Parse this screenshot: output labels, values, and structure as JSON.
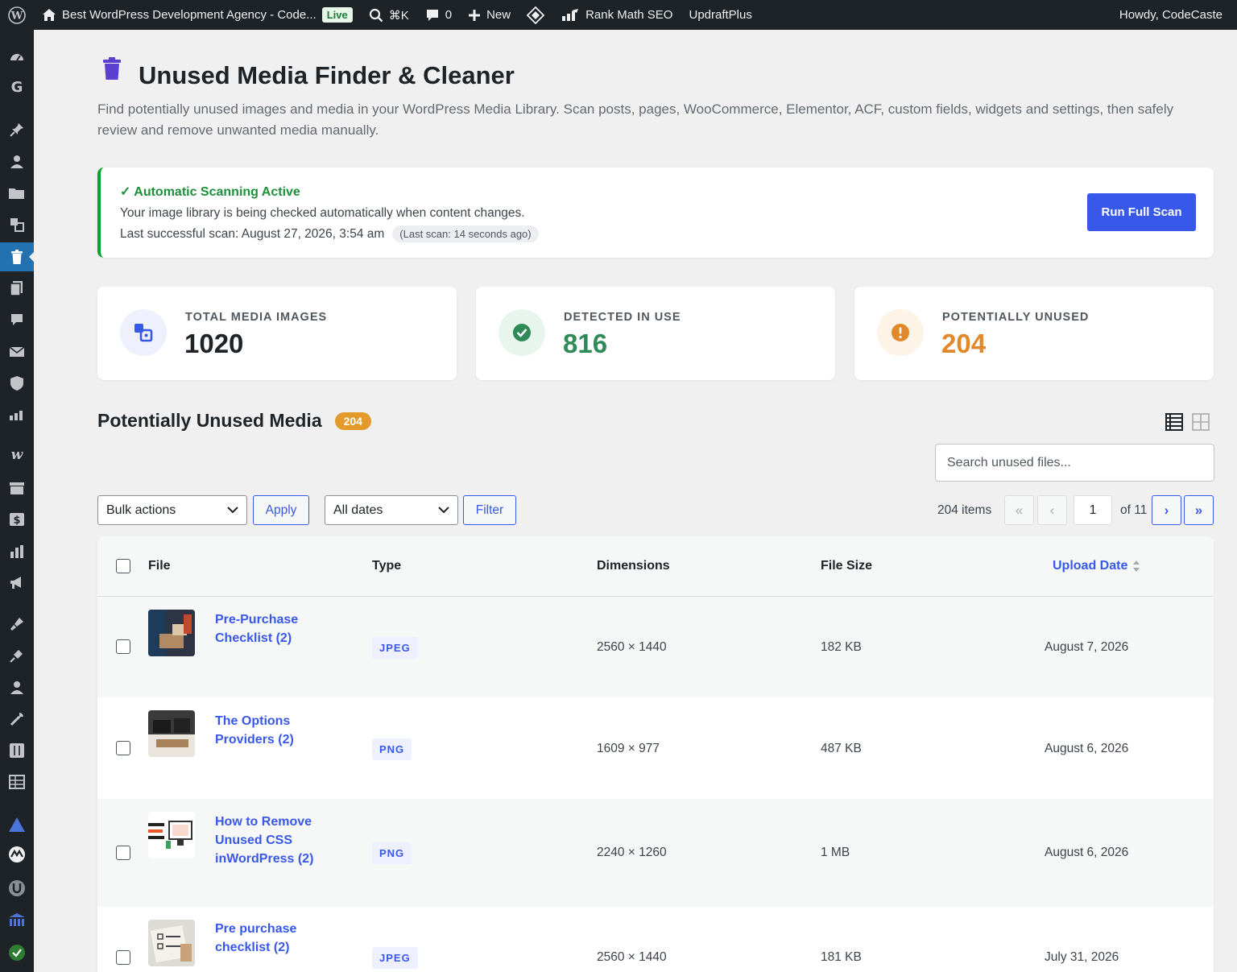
{
  "adminbar": {
    "site_title": "Best WordPress Development Agency - Code...",
    "live_label": "Live",
    "shortcut_label": "⌘K",
    "comments_count": "0",
    "new_label": "New",
    "rankmath_label": "Rank Math SEO",
    "updraft_label": "UpdraftPlus",
    "howdy_label": "Howdy, CodeCaste"
  },
  "page": {
    "title": "Unused Media Finder & Cleaner",
    "description": "Find potentially unused images and media in your WordPress Media Library. Scan posts, pages, WooCommerce, Elementor, ACF, custom fields, widgets and settings, then safely review and remove unwanted media manually."
  },
  "notice": {
    "title": "✓ Automatic Scanning Active",
    "line1": "Your image library is being checked automatically when content changes.",
    "line2": "Last successful scan: August 27, 2026, 3:54 am",
    "pill": "(Last scan: 14 seconds ago)",
    "button_label": "Run Full Scan"
  },
  "stats": [
    {
      "label": "TOTAL MEDIA IMAGES",
      "value": "1020",
      "color": "#1d2327"
    },
    {
      "label": "DETECTED IN USE",
      "value": "816",
      "color": "#2e8b57"
    },
    {
      "label": "POTENTIALLY UNUSED",
      "value": "204",
      "color": "#e0882a"
    }
  ],
  "section": {
    "title": "Potentially Unused Media",
    "count": "204"
  },
  "search": {
    "placeholder": "Search unused files..."
  },
  "filters": {
    "bulk_actions": "Bulk actions",
    "apply_label": "Apply",
    "dates": "All dates",
    "filter_label": "Filter"
  },
  "pagination": {
    "items": "204 items",
    "first": "«",
    "prev": "‹",
    "current_page": "1",
    "of_pages": "of 11",
    "next": "›",
    "last": "»"
  },
  "table": {
    "columns": {
      "file": "File",
      "type": "Type",
      "dimensions": "Dimensions",
      "file_size": "File Size",
      "upload_date": "Upload Date"
    },
    "rows": [
      {
        "file": "Pre-Purchase Checklist (2)",
        "type": "JPEG",
        "dimensions": "2560 × 1440",
        "size": "182 KB",
        "date": "August 7, 2026"
      },
      {
        "file": "The Options Providers (2)",
        "type": "PNG",
        "dimensions": "1609 × 977",
        "size": "487 KB",
        "date": "August 6, 2026"
      },
      {
        "file": "How to Remove Unused CSS inWordPress (2)",
        "type": "PNG",
        "dimensions": "2240 × 1260",
        "size": "1 MB",
        "date": "August 6, 2026"
      },
      {
        "file": "Pre purchase checklist (2)",
        "type": "JPEG",
        "dimensions": "2560 × 1440",
        "size": "181 KB",
        "date": "July 31, 2026"
      }
    ]
  },
  "colors": {
    "accent": "#3858e9",
    "success": "#00a32a",
    "warning": "#e0882a",
    "adminbar": "#1d2327"
  }
}
